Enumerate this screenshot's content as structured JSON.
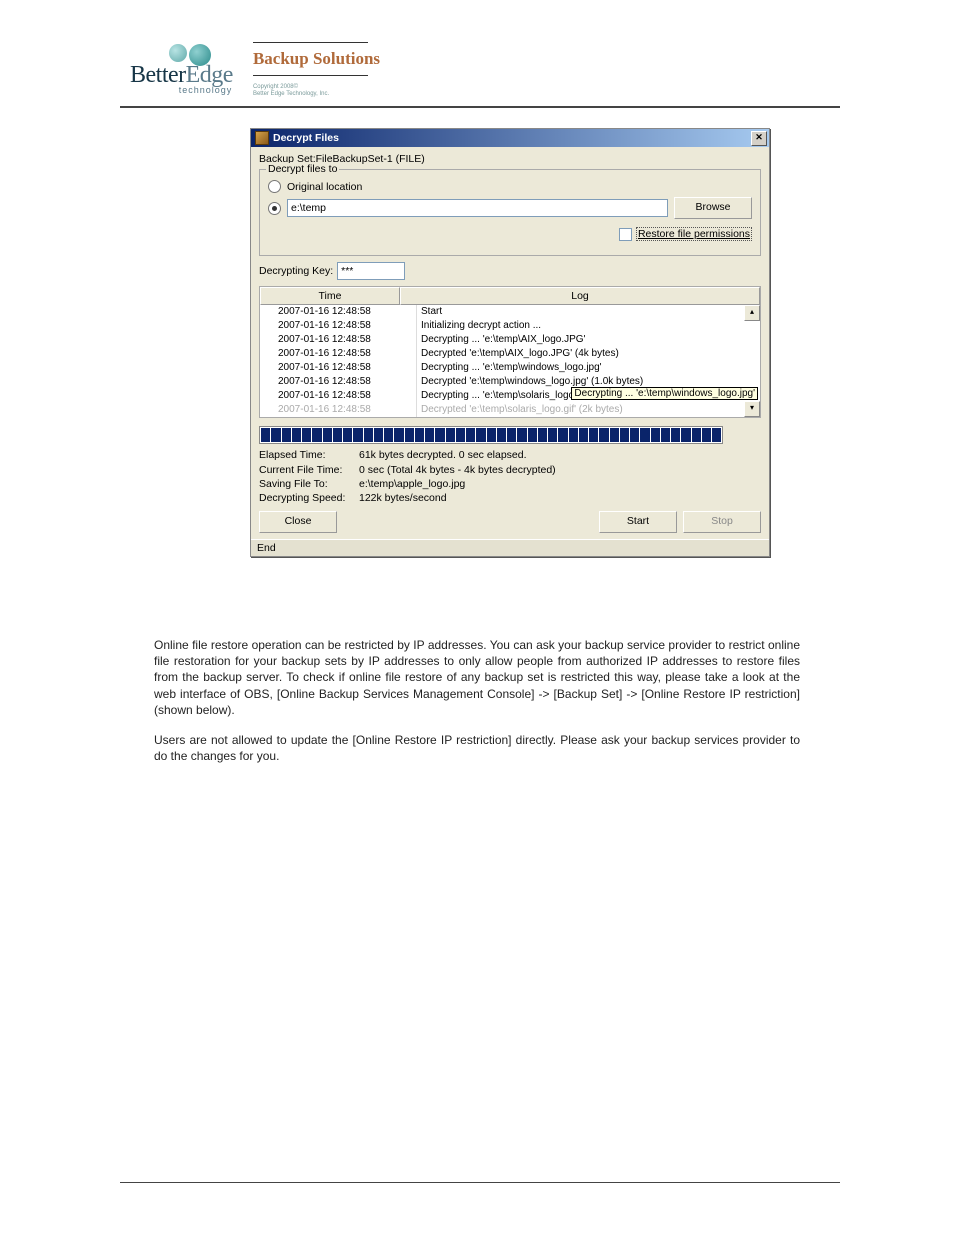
{
  "header": {
    "brand_a": "Better",
    "brand_b": "Edge",
    "brand_sub": "technology",
    "title": "Backup Solutions",
    "copyright_l1": "Copyright 2008©",
    "copyright_l2": "Better Edge Technology, Inc."
  },
  "dialog": {
    "title": "Decrypt Files",
    "backup_set_label": "Backup Set:",
    "backup_set_value": "FileBackupSet-1 (FILE)",
    "fieldset_legend": "Decrypt files to",
    "radio_original": "Original location",
    "path_value": "e:\\temp",
    "browse": "Browse",
    "restore_perm": "Restore file permissions",
    "key_label": "Decrypting Key:",
    "key_value": "***",
    "col_time": "Time",
    "col_log": "Log",
    "log": [
      {
        "t": "2007-01-16 12:48:58",
        "m": "Start"
      },
      {
        "t": "2007-01-16 12:48:58",
        "m": "Initializing decrypt action ..."
      },
      {
        "t": "2007-01-16 12:48:58",
        "m": "Decrypting ... 'e:\\temp\\AIX_logo.JPG'"
      },
      {
        "t": "2007-01-16 12:48:58",
        "m": "Decrypted 'e:\\temp\\AIX_logo.JPG' (4k bytes)"
      },
      {
        "t": "2007-01-16 12:48:58",
        "m": "Decrypting ... 'e:\\temp\\windows_logo.jpg'"
      },
      {
        "t": "2007-01-16 12:48:58",
        "m": "Decrypted 'e:\\temp\\windows_logo.jpg' (1.0k bytes)"
      },
      {
        "t": "2007-01-16 12:48:58",
        "m": "Decrypting ... 'e:\\temp\\solaris_logo'"
      },
      {
        "t": "2007-01-16 12:48:58",
        "m": "Decrypted 'e:\\temp\\solaris_logo.gif' (2k bytes)"
      }
    ],
    "tooltip": "Decrypting ... 'e:\\temp\\windows_logo.jpg'",
    "elapsed_k": "Elapsed Time:",
    "elapsed_v": "61k bytes decrypted. 0 sec elapsed.",
    "current_k": "Current File Time:",
    "current_v": "0 sec (Total 4k bytes - 4k bytes decrypted)",
    "saving_k": "Saving File To:",
    "saving_v": "e:\\temp\\apple_logo.jpg",
    "speed_k": "Decrypting Speed:",
    "speed_v": "122k bytes/second",
    "close": "Close",
    "start": "Start",
    "stop": "Stop",
    "status": "End"
  },
  "body": {
    "p1": "Online file restore operation can be restricted by IP addresses. You can ask your backup service provider to restrict online file restoration for your backup sets by IP addresses to only allow people from authorized IP addresses to restore files from the backup server. To check if online file restore of any backup set is restricted this way, please take a look at the web interface of OBS, [Online Backup Services Management Console] -> [Backup Set] -> [Online Restore IP restriction] (shown below).",
    "p2": "Users are not allowed to update the [Online Restore IP restriction] directly. Please ask your backup services provider to do the changes for you."
  }
}
